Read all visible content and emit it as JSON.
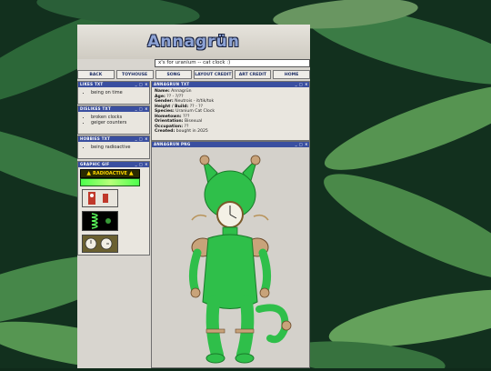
{
  "site": {
    "title": "Annagrün",
    "marquee": "x's for uranium -- cat clock :)"
  },
  "nav": [
    "BACK",
    "TOYHOUSE",
    "SONG",
    "LAYOUT CREDIT",
    "ART CREDIT",
    "HOME"
  ],
  "likes": {
    "title": "LIKES TXT",
    "items": [
      "being on time"
    ]
  },
  "dislikes": {
    "title": "DISLIKES TXT",
    "items": [
      "broken clocks",
      "geiger counters"
    ]
  },
  "hobbies": {
    "title": "HOBBIES TXT",
    "items": [
      "being radioactive"
    ]
  },
  "gifs": {
    "title": "GRAPHIC GIF",
    "radioactive_label": "RADIOACTIVE"
  },
  "info": {
    "title": "ANNAGRUN TXT",
    "rows": [
      {
        "label": "Name:",
        "value": "Annagrün"
      },
      {
        "label": "Age:",
        "value": "?? - ?/??"
      },
      {
        "label": "Gender:",
        "value": "Neutrois - it/tik/tok"
      },
      {
        "label": "Height / Build:",
        "value": "?? - ??"
      },
      {
        "label": "Species:",
        "value": "Uranium Cat Clock"
      },
      {
        "label": "Hometown:",
        "value": "???"
      },
      {
        "label": "Orientation:",
        "value": "Bisexual"
      },
      {
        "label": "Occupation:",
        "value": "??"
      },
      {
        "label": "Created:",
        "value": "bought in 2025"
      }
    ]
  },
  "image_panel": {
    "title": "ANNAGRUN PNG"
  },
  "window_controls": "_ □ ×",
  "colors": {
    "panel_header": "#3a4fa0",
    "page_bg": "#d8d5cf",
    "character_green": "#2fbf4a",
    "title_text": "#8da3d6"
  }
}
